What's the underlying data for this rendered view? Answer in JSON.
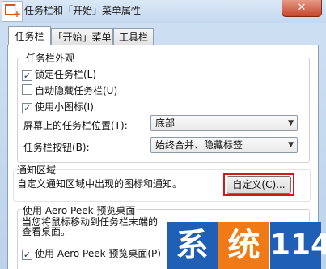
{
  "window": {
    "title": "任务栏和「开始」菜单属性",
    "close_label": "✕"
  },
  "tabs": [
    {
      "label": "任务栏",
      "active": true
    },
    {
      "label": "「开始」菜单",
      "active": false
    },
    {
      "label": "工具栏",
      "active": false
    }
  ],
  "appearance": {
    "title": "任务栏外观",
    "lock_taskbar": {
      "label": "锁定任务栏(L)",
      "checked": true
    },
    "auto_hide": {
      "label": "自动隐藏任务栏(U)",
      "checked": false
    },
    "small_icons": {
      "label": "使用小图标(I)",
      "checked": true
    },
    "location_label": "屏幕上的任务栏位置(T):",
    "location_value": "底部",
    "buttons_label": "任务栏按钮(B):",
    "buttons_value": "始终合并、隐藏标签"
  },
  "notification": {
    "title": "通知区域",
    "description": "自定义通知区域中出现的图标和通知。",
    "customize_label": "自定义(C)..."
  },
  "aero_peek": {
    "title": "使用 Aero Peek 预览桌面",
    "description_line1": "当您将鼠标移动到任务栏末端的",
    "description_line2": "查看桌面。",
    "checkbox": {
      "label": "使用 Aero Peek 预览桌面(P)",
      "checked": true
    }
  },
  "watermark": {
    "chars": [
      "系",
      "统",
      "114"
    ],
    "colors": [
      "#1f5fb5",
      "#f07a16",
      "#1f5fb5"
    ]
  }
}
